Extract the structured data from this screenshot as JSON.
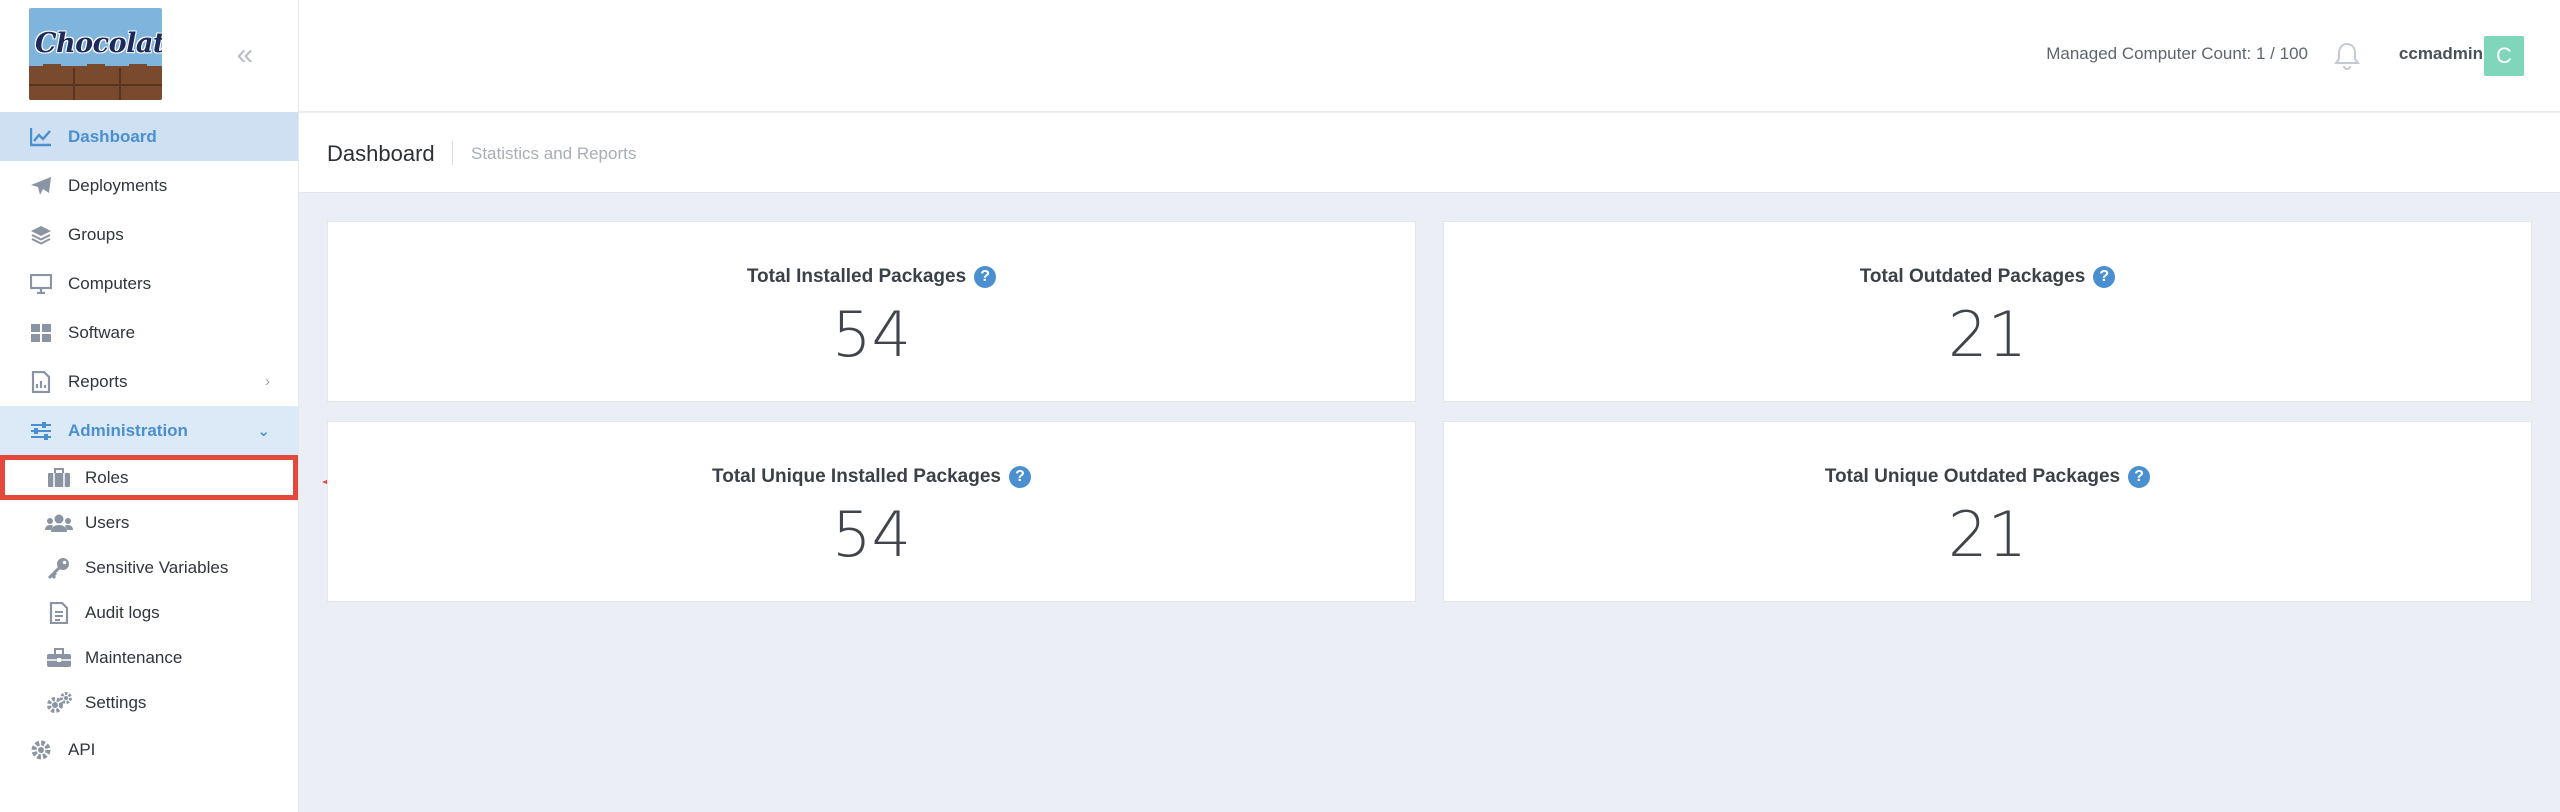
{
  "brand": {
    "logo_text": "Chocolatey"
  },
  "sidebar": {
    "items": [
      {
        "label": "Dashboard",
        "icon": "chart-line-icon"
      },
      {
        "label": "Deployments",
        "icon": "paper-plane-icon"
      },
      {
        "label": "Groups",
        "icon": "layers-icon"
      },
      {
        "label": "Computers",
        "icon": "desktop-icon"
      },
      {
        "label": "Software",
        "icon": "grid-icon"
      },
      {
        "label": "Reports",
        "icon": "file-chart-icon"
      },
      {
        "label": "Administration",
        "icon": "sliders-icon"
      }
    ],
    "admin_items": [
      {
        "label": "Roles",
        "icon": "briefcase-icon"
      },
      {
        "label": "Users",
        "icon": "users-icon"
      },
      {
        "label": "Sensitive Variables",
        "icon": "key-icon"
      },
      {
        "label": "Audit logs",
        "icon": "file-text-icon"
      },
      {
        "label": "Maintenance",
        "icon": "toolbox-icon"
      },
      {
        "label": "Settings",
        "icon": "gears-icon"
      }
    ],
    "api_item": {
      "label": "API",
      "icon": "gear-icon"
    }
  },
  "topbar": {
    "managed_count": "Managed Computer Count: 1 / 100",
    "username": "ccmadmin",
    "avatar_letter": "C"
  },
  "page": {
    "title": "Dashboard",
    "subtitle": "Statistics and Reports"
  },
  "stats": [
    {
      "label": "Total Installed Packages",
      "value": "54"
    },
    {
      "label": "Total Outdated Packages",
      "value": "21"
    },
    {
      "label": "Total Unique Installed Packages",
      "value": "54"
    },
    {
      "label": "Total Unique Outdated Packages",
      "value": "21"
    }
  ],
  "colors": {
    "accent": "#4a90d0",
    "active_bg": "#cfe0f2",
    "highlight": "#e4473c",
    "avatar": "#7fd6bb"
  }
}
